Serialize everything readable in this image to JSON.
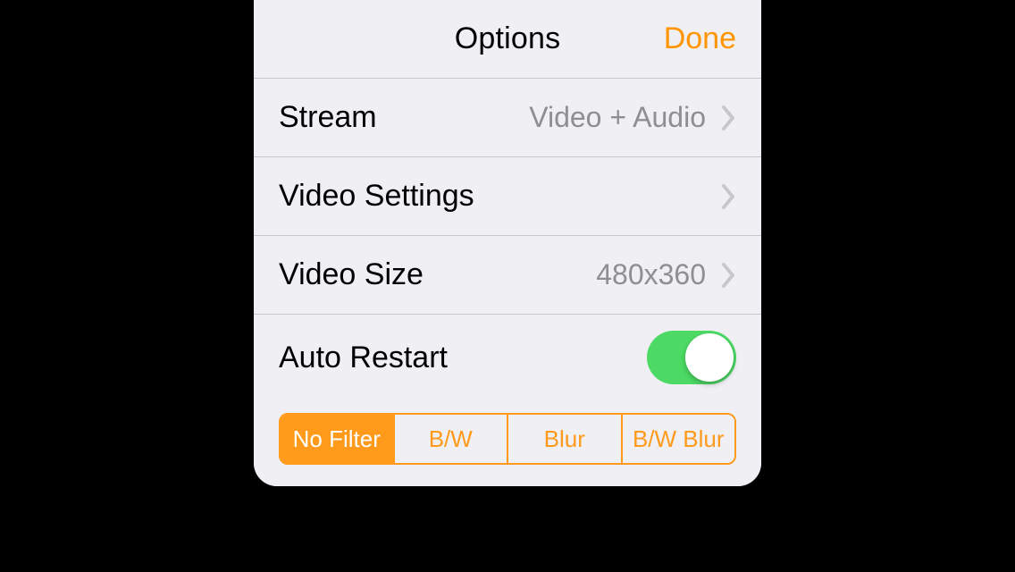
{
  "header": {
    "title": "Options",
    "done_label": "Done"
  },
  "rows": {
    "stream": {
      "label": "Stream",
      "value": "Video + Audio"
    },
    "video_settings": {
      "label": "Video Settings",
      "value": ""
    },
    "video_size": {
      "label": "Video Size",
      "value": "480x360"
    },
    "auto_restart": {
      "label": "Auto Restart",
      "on": true
    }
  },
  "filters": {
    "selected_index": 0,
    "options": [
      "No Filter",
      "B/W",
      "Blur",
      "B/W Blur"
    ]
  },
  "colors": {
    "accent": "#ff9500",
    "switch_on": "#4cd964"
  }
}
